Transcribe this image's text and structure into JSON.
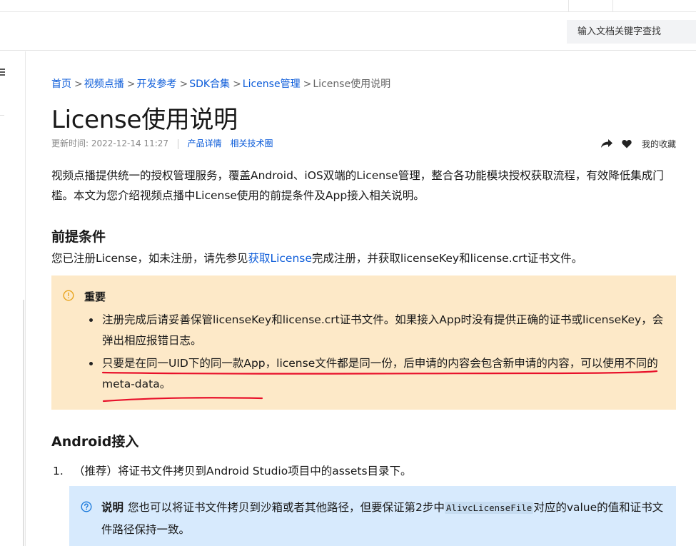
{
  "header": {
    "search_placeholder": "输入文档关键字查找"
  },
  "breadcrumb": {
    "items": [
      "首页",
      "视频点播",
      "开发参考",
      "SDK合集",
      "License管理"
    ],
    "separator": ">",
    "current": "License使用说明"
  },
  "page": {
    "title": "License使用说明",
    "updated_label": "更新时间:",
    "updated_time": "2022-12-14 11:27",
    "links": [
      "产品详情",
      "相关技术圈"
    ],
    "favorite_label": "我的收藏"
  },
  "intro": "视频点播提供统一的授权管理服务，覆盖Android、iOS双端的License管理，整合各功能模块授权获取流程，有效降低集成门槛。本文为您介绍视频点播中License使用的前提条件及App接入相关说明。",
  "prereq": {
    "heading": "前提条件",
    "text_before": "您已注册License，如未注册，请先参见",
    "link": "获取License",
    "text_after": "完成注册，并获取licenseKey和license.crt证书文件。"
  },
  "important": {
    "title": "重要",
    "items": [
      "注册完成后请妥善保管licenseKey和license.crt证书文件。如果接入App时没有提供正确的证书或licenseKey，会弹出相应报错日志。",
      "只要是在同一UID下的同一款App，license文件都是同一份，后申请的内容会包含新申请的内容，可以使用不同的meta-data。"
    ],
    "annotation_color": "#e8102a"
  },
  "android": {
    "heading": "Android接入",
    "step_number": "1.",
    "step_text": "（推荐）将证书文件拷贝到Android Studio项目中的assets目录下。",
    "note_title": "说明",
    "note_before": "您也可以将证书文件拷贝到沙箱或者其他路径，但要保证第2步中",
    "note_code": "AlivcLicenseFile",
    "note_after": "对应的value的值和证书文件路径保持一致。"
  },
  "colors": {
    "link": "#0b5bd9",
    "important_bg": "#fde9c8",
    "note_bg": "#d7eafd",
    "important_icon": "#e8a21a",
    "note_icon": "#1d7bdc"
  },
  "icons": {
    "share": "share-icon",
    "favorite": "heart-icon",
    "important": "warning-circle-icon",
    "note": "question-circle-icon",
    "sidebar": "menu-icon"
  }
}
